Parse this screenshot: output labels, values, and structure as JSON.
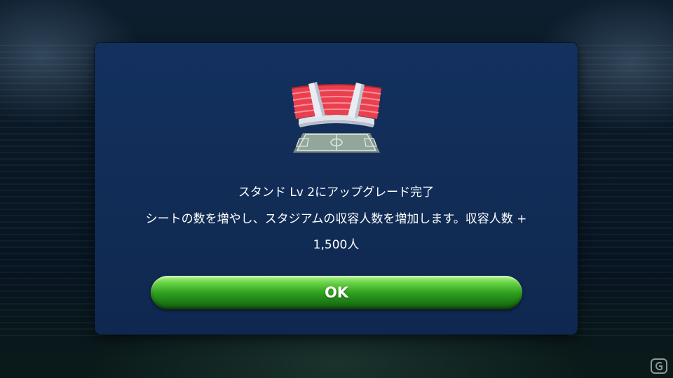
{
  "dialog": {
    "title": "スタンド Lv 2にアップグレード完了",
    "description_line1": "シートの数を増やし、スタジアムの収容人数を増加します。収容人数 +",
    "description_line2": "1,500人",
    "ok_label": "OK"
  },
  "icons": {
    "stadium": "stadium-stand-icon",
    "watermark": "site-logo-watermark"
  },
  "colors": {
    "dialog_bg": "#13315f",
    "stand_red": "#e8404f",
    "button_green": "#2fa21f"
  }
}
